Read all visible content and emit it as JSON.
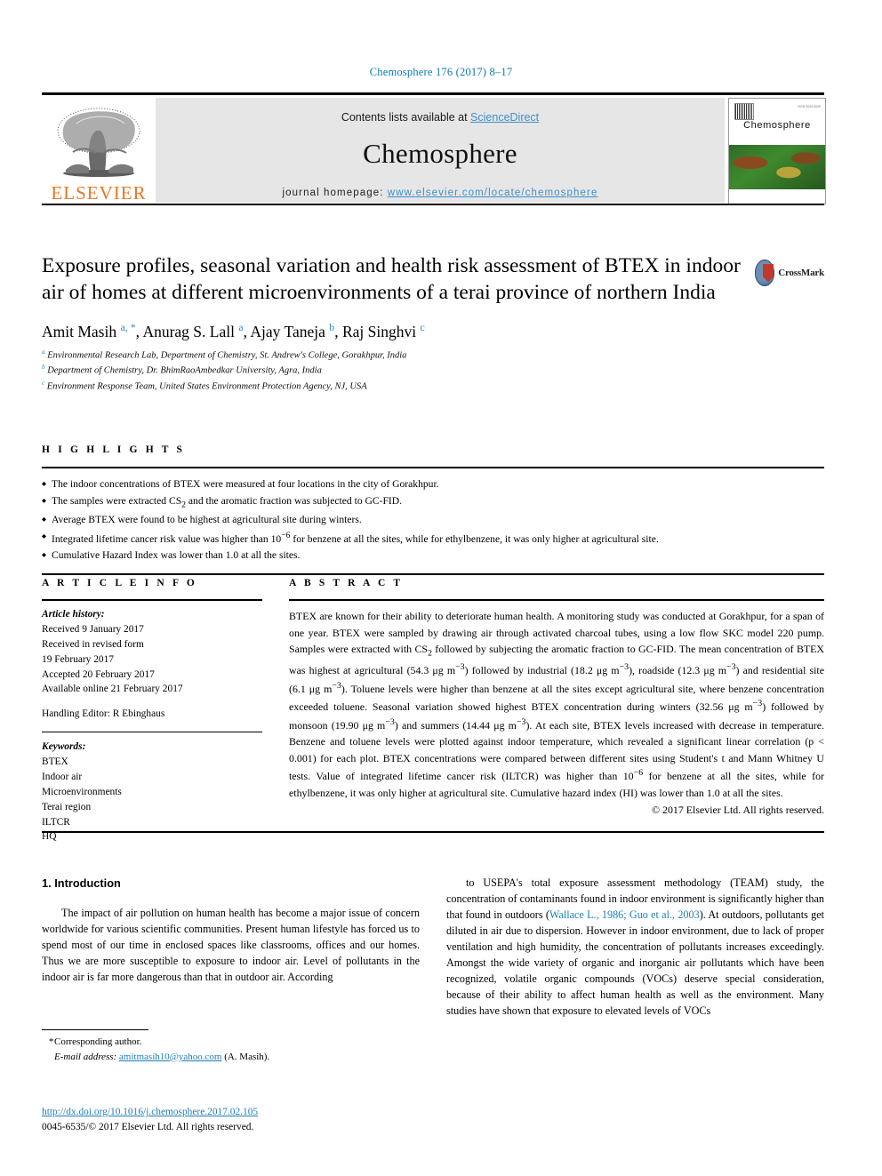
{
  "running_head": "Chemosphere 176 (2017) 8–17",
  "masthead": {
    "contents_prefix": "Contents lists available at ",
    "contents_link": "ScienceDirect",
    "journal_title": "Chemosphere",
    "homepage_prefix": "journal homepage: ",
    "homepage_url": "www.elsevier.com/locate/chemosphere",
    "publisher_logo_text": "ELSEVIER",
    "cover_title": "Chemosphere",
    "cover_corner_text": "ISSN 0045-6535"
  },
  "article": {
    "title": "Exposure profiles, seasonal variation and health risk assessment of BTEX in indoor air of homes at different microenvironments of a terai province of northern India",
    "crossmark_label": "CrossMark",
    "authors_html": "Amit Masih <sup class=\"auth-sup\">a, *</sup>, Anurag S. Lall <sup class=\"auth-sup\">a</sup>, Ajay Taneja <sup class=\"auth-sup\">b</sup>, Raj Singhvi <sup class=\"auth-sup\">c</sup>",
    "affiliations": [
      {
        "marker": "a",
        "text": "Environmental Research Lab, Department of Chemistry, St. Andrew's College, Gorakhpur, India"
      },
      {
        "marker": "b",
        "text": "Department of Chemistry, Dr. BhimRaoAmbedkar University, Agra, India"
      },
      {
        "marker": "c",
        "text": "Environment Response Team, United States Environment Protection Agency, NJ, USA"
      }
    ]
  },
  "highlights": {
    "heading": "H I G H L I G H T S",
    "items_html": [
      "The indoor concentrations of BTEX were measured at four locations in the city of Gorakhpur.",
      "The samples were extracted CS<sub>2</sub> and the aromatic fraction was subjected to GC-FID.",
      "Average BTEX were found to be highest at agricultural site during winters.",
      "Integrated lifetime cancer risk value was higher than 10<sup>−6</sup> for benzene at all the sites, while for ethylbenzene, it was only higher at agricultural site.",
      "Cumulative Hazard Index was lower than 1.0 at all the sites."
    ]
  },
  "article_info": {
    "heading": "A R T I C L E   I N F O",
    "history_label": "Article history:",
    "history_lines": [
      "Received 9 January 2017",
      "Received in revised form",
      "19 February 2017",
      "Accepted 20 February 2017",
      "Available online 21 February 2017"
    ],
    "handling_editor": "Handling Editor: R Ebinghaus",
    "keywords_label": "Keywords:",
    "keywords": [
      "BTEX",
      "Indoor air",
      "Microenvironments",
      "Terai region",
      "ILTCR",
      "HQ"
    ]
  },
  "abstract": {
    "heading": "A B S T R A C T",
    "body_html": "BTEX are known for their ability to deteriorate human health. A monitoring study was conducted at Gorakhpur, for a span of one year. BTEX were sampled by drawing air through activated charcoal tubes, using a low flow SKC model 220 pump. Samples were extracted with CS<sub>2</sub> followed by subjecting the aromatic fraction to GC-FID. The mean concentration of BTEX was highest at agricultural (54.3 &mu;g m<sup>−3</sup>) followed by industrial (18.2 &mu;g m<sup>−3</sup>), roadside (12.3 &mu;g m<sup>−3</sup>) and residential site (6.1 &mu;g m<sup>−3</sup>). Toluene levels were higher than benzene at all the sites except agricultural site, where benzene concentration exceeded toluene. Seasonal variation showed highest BTEX concentration during winters (32.56 &mu;g m<sup>−3</sup>) followed by monsoon (19.90 &mu;g m<sup>−3</sup>) and summers (14.44 &mu;g m<sup>−3</sup>). At each site, BTEX levels increased with decrease in temperature. Benzene and toluene levels were plotted against indoor temperature, which revealed a significant linear correlation (p &lt; 0.001) for each plot. BTEX concentrations were compared between different sites using Student's t and Mann Whitney U tests. Value of integrated lifetime cancer risk (ILTCR) was higher than 10<sup>−6</sup> for benzene at all the sites, while for ethylbenzene, it was only higher at agricultural site. Cumulative hazard index (HI) was lower than 1.0 at all the sites.",
    "copyright": "© 2017 Elsevier Ltd. All rights reserved."
  },
  "introduction": {
    "heading": "1. Introduction",
    "left_paragraph": "The impact of air pollution on human health has become a major issue of concern worldwide for various scientific communities. Present human lifestyle has forced us to spend most of our time in enclosed spaces like classrooms, offices and our homes. Thus we are more susceptible to exposure to indoor air. Level of pollutants in the indoor air is far more dangerous than that in outdoor air. According",
    "right_paragraph_html": "to USEPA's total exposure assessment methodology (TEAM) study, the concentration of contaminants found in indoor environment is significantly higher than that found in outdoors (<span class=\"ref-link\">Wallace L., 1986; Guo et al., 2003</span>). At outdoors, pollutants get diluted in air due to dispersion. However in indoor environment, due to lack of proper ventilation and high humidity, the concentration of pollutants increases exceedingly. Amongst the wide variety of organic and inorganic air pollutants which have been recognized, volatile organic compounds (VOCs) deserve special consideration, because of their ability to affect human health as well as the environment. Many studies have shown that exposure to elevated levels of VOCs"
  },
  "footnote": {
    "corresponding_author": "Corresponding author.",
    "email_label": "E-mail address:",
    "email": "amitmasih10@yahoo.com",
    "email_suffix": "(A. Masih).",
    "doi_url": "http://dx.doi.org/10.1016/j.chemosphere.2017.02.105",
    "issn_line": "0045-6535/© 2017 Elsevier Ltd. All rights reserved."
  }
}
